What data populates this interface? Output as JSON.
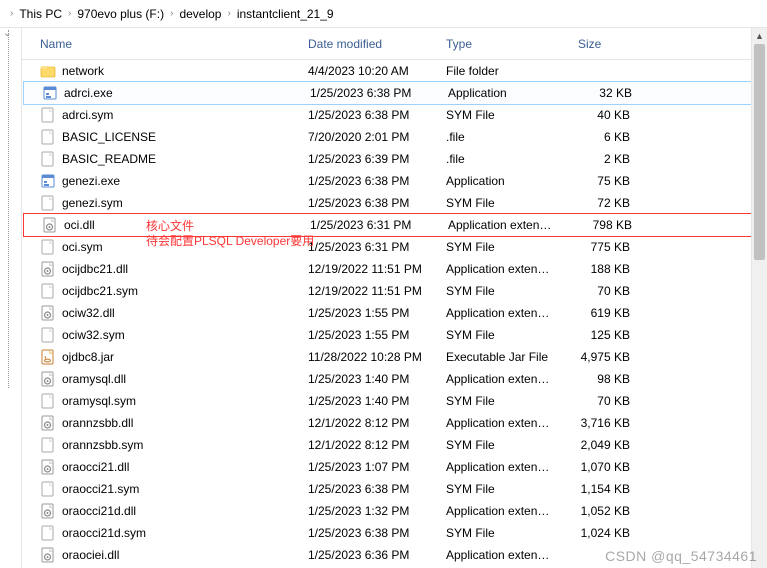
{
  "breadcrumb": {
    "items": [
      "This PC",
      "970evo plus (F:)",
      "develop",
      "instantclient_21_9"
    ]
  },
  "columns": {
    "name": "Name",
    "date": "Date modified",
    "type": "Type",
    "size": "Size"
  },
  "annotation": {
    "line1": "核心文件",
    "line2": "待会配置PLSQL Developer要用"
  },
  "watermark": "CSDN @qq_54734461",
  "files": [
    {
      "name": "network",
      "date": "4/4/2023 10:20 AM",
      "type": "File folder",
      "size": "",
      "icon": "folder"
    },
    {
      "name": "adrci.exe",
      "date": "1/25/2023 6:38 PM",
      "type": "Application",
      "size": "32 KB",
      "icon": "exe",
      "selected": true
    },
    {
      "name": "adrci.sym",
      "date": "1/25/2023 6:38 PM",
      "type": "SYM File",
      "size": "40 KB",
      "icon": "file"
    },
    {
      "name": "BASIC_LICENSE",
      "date": "7/20/2020 2:01 PM",
      "type": ".file",
      "size": "6 KB",
      "icon": "file"
    },
    {
      "name": "BASIC_README",
      "date": "1/25/2023 6:39 PM",
      "type": ".file",
      "size": "2 KB",
      "icon": "file"
    },
    {
      "name": "genezi.exe",
      "date": "1/25/2023 6:38 PM",
      "type": "Application",
      "size": "75 KB",
      "icon": "exe"
    },
    {
      "name": "genezi.sym",
      "date": "1/25/2023 6:38 PM",
      "type": "SYM File",
      "size": "72 KB",
      "icon": "file"
    },
    {
      "name": "oci.dll",
      "date": "1/25/2023 6:31 PM",
      "type": "Application exten…",
      "size": "798 KB",
      "icon": "dll",
      "annotated": true
    },
    {
      "name": "oci.sym",
      "date": "1/25/2023 6:31 PM",
      "type": "SYM File",
      "size": "775 KB",
      "icon": "file"
    },
    {
      "name": "ocijdbc21.dll",
      "date": "12/19/2022 11:51 PM",
      "type": "Application exten…",
      "size": "188 KB",
      "icon": "dll"
    },
    {
      "name": "ocijdbc21.sym",
      "date": "12/19/2022 11:51 PM",
      "type": "SYM File",
      "size": "70 KB",
      "icon": "file"
    },
    {
      "name": "ociw32.dll",
      "date": "1/25/2023 1:55 PM",
      "type": "Application exten…",
      "size": "619 KB",
      "icon": "dll"
    },
    {
      "name": "ociw32.sym",
      "date": "1/25/2023 1:55 PM",
      "type": "SYM File",
      "size": "125 KB",
      "icon": "file"
    },
    {
      "name": "ojdbc8.jar",
      "date": "11/28/2022 10:28 PM",
      "type": "Executable Jar File",
      "size": "4,975 KB",
      "icon": "jar"
    },
    {
      "name": "oramysql.dll",
      "date": "1/25/2023 1:40 PM",
      "type": "Application exten…",
      "size": "98 KB",
      "icon": "dll"
    },
    {
      "name": "oramysql.sym",
      "date": "1/25/2023 1:40 PM",
      "type": "SYM File",
      "size": "70 KB",
      "icon": "file"
    },
    {
      "name": "orannzsbb.dll",
      "date": "12/1/2022 8:12 PM",
      "type": "Application exten…",
      "size": "3,716 KB",
      "icon": "dll"
    },
    {
      "name": "orannzsbb.sym",
      "date": "12/1/2022 8:12 PM",
      "type": "SYM File",
      "size": "2,049 KB",
      "icon": "file"
    },
    {
      "name": "oraocci21.dll",
      "date": "1/25/2023 1:07 PM",
      "type": "Application exten…",
      "size": "1,070 KB",
      "icon": "dll"
    },
    {
      "name": "oraocci21.sym",
      "date": "1/25/2023 6:38 PM",
      "type": "SYM File",
      "size": "1,154 KB",
      "icon": "file"
    },
    {
      "name": "oraocci21d.dll",
      "date": "1/25/2023 1:32 PM",
      "type": "Application exten…",
      "size": "1,052 KB",
      "icon": "dll"
    },
    {
      "name": "oraocci21d.sym",
      "date": "1/25/2023 6:38 PM",
      "type": "SYM File",
      "size": "1,024 KB",
      "icon": "file"
    },
    {
      "name": "oraociei.dll",
      "date": "1/25/2023 6:36 PM",
      "type": "Application exten…",
      "size": "",
      "icon": "dll"
    }
  ]
}
